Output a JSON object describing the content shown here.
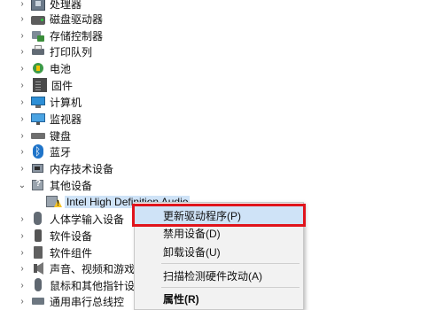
{
  "tree": {
    "items": [
      {
        "label": "处理器",
        "icon": "processor-icon"
      },
      {
        "label": "磁盘驱动器",
        "icon": "disk-drive-icon"
      },
      {
        "label": "存储控制器",
        "icon": "storage-controller-icon"
      },
      {
        "label": "打印队列",
        "icon": "printer-icon"
      },
      {
        "label": "电池",
        "icon": "battery-icon"
      },
      {
        "label": "固件",
        "icon": "firmware-icon"
      },
      {
        "label": "计算机",
        "icon": "computer-icon"
      },
      {
        "label": "监视器",
        "icon": "monitor-icon"
      },
      {
        "label": "键盘",
        "icon": "keyboard-icon"
      },
      {
        "label": "蓝牙",
        "icon": "bluetooth-icon"
      },
      {
        "label": "内存技术设备",
        "icon": "memory-device-icon"
      },
      {
        "label": "其他设备",
        "icon": "other-devices-icon"
      },
      {
        "label": "Intel High Definition Audio",
        "icon": "warning-device-icon"
      },
      {
        "label": "人体学输入设备",
        "icon": "hid-icon"
      },
      {
        "label": "软件设备",
        "icon": "software-device-icon"
      },
      {
        "label": "软件组件",
        "icon": "software-component-icon"
      },
      {
        "label": "声音、视频和游戏控",
        "icon": "sound-icon"
      },
      {
        "label": "鼠标和其他指针设备",
        "icon": "mouse-icon"
      },
      {
        "label": "通用串行总线控",
        "icon": "usb-icon"
      }
    ]
  },
  "context_menu": {
    "update_driver": "更新驱动程序(P)",
    "disable_device": "禁用设备(D)",
    "uninstall_device": "卸载设备(U)",
    "scan_hardware": "扫描检测硬件改动(A)",
    "properties": "属性(R)"
  },
  "colors": {
    "highlight_border": "#e0141c",
    "highlight_bg": "#cfe3f7"
  }
}
